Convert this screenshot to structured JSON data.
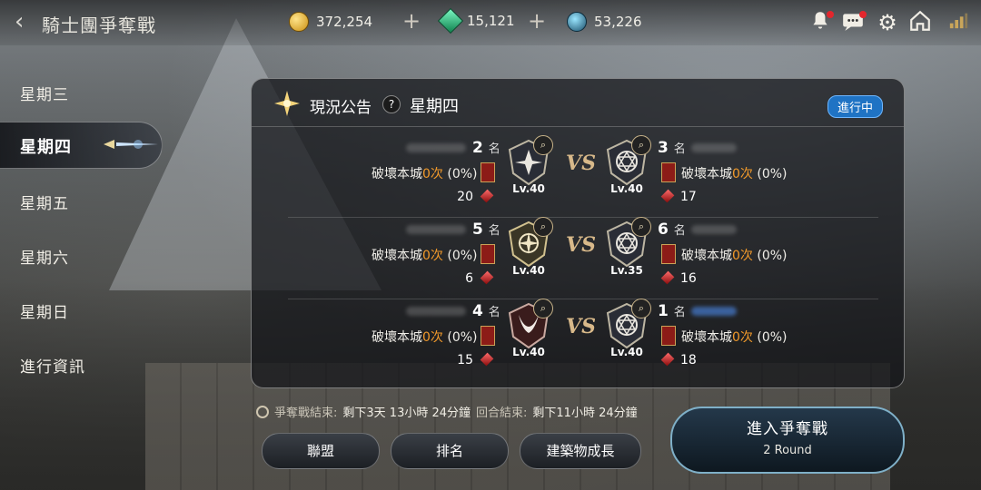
{
  "header": {
    "back_icon": "chevron-left-icon",
    "title": "騎士團爭奪戰",
    "resources": [
      {
        "icon": "gold-coin-icon",
        "value": "372,254"
      },
      {
        "icon": "green-gem-icon",
        "value": "15,121"
      },
      {
        "icon": "blue-orb-icon",
        "value": "53,226"
      }
    ],
    "icons": [
      "bell-icon",
      "chat-icon",
      "gear-icon",
      "home-icon",
      "signal-icon"
    ]
  },
  "days": {
    "items": [
      "星期三",
      "星期四",
      "星期五",
      "星期六",
      "星期日",
      "進行資訊"
    ],
    "active": "星期四"
  },
  "panel": {
    "notice_label": "現況公告",
    "help": "?",
    "day_title": "星期四",
    "status": "進行中",
    "destroy_text": "破壞本城",
    "count_text": "0次",
    "percent_text": "(0%)",
    "vs": "VS",
    "matches": [
      {
        "left": {
          "rank": "2",
          "score": "20",
          "level": "Lv.40"
        },
        "right": {
          "rank": "3",
          "score": "17",
          "level": "Lv.40"
        }
      },
      {
        "left": {
          "rank": "5",
          "score": "6",
          "level": "Lv.40"
        },
        "right": {
          "rank": "6",
          "score": "16",
          "level": "Lv.35"
        }
      },
      {
        "left": {
          "rank": "4",
          "score": "15",
          "level": "Lv.40"
        },
        "right": {
          "rank": "1",
          "score": "18",
          "level": "Lv.40"
        }
      }
    ],
    "rank_suffix": "名"
  },
  "timer": {
    "war_end_label": "爭奪戰結束:",
    "war_end_value": "剩下3天  13小時  24分鐘",
    "round_end_label": "回合結束:",
    "round_end_value": "剩下11小時  24分鐘"
  },
  "buttons": {
    "alliance": "聯盟",
    "ranking": "排名",
    "building": "建築物成長",
    "enter": "進入爭奪戰",
    "round": "2 Round"
  },
  "colors": {
    "accent_orange": "#f29a2b",
    "status_blue": "#1f73c4"
  }
}
